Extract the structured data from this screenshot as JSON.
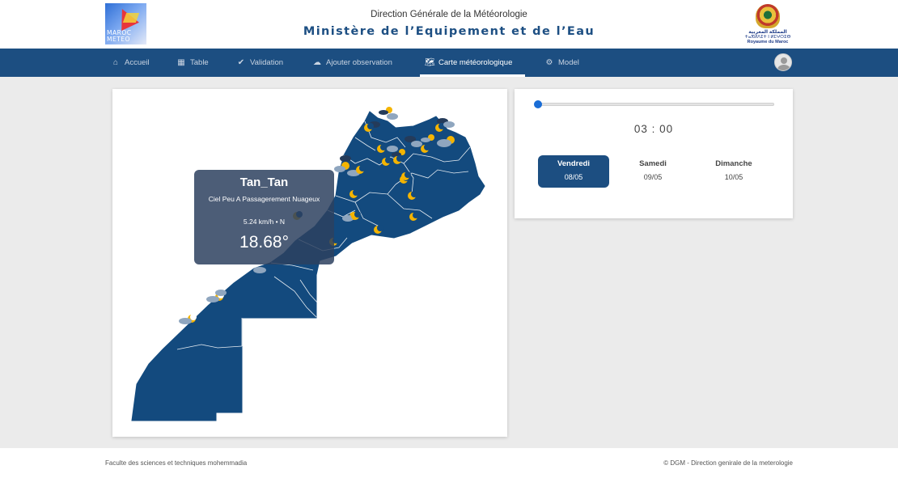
{
  "header": {
    "left_logo": {
      "icon": "meteo-maroc-logo",
      "lines": [
        "MAROC",
        "METEO"
      ]
    },
    "title_line1": "Direction Générale de la Météorologie",
    "title_line2": "Ministère de l’Equipement et de l’Eau",
    "right_logo": {
      "icon": "kingdom-crest-logo",
      "line1": "المملكة المغربية",
      "line2": "ⵜⴰⴳⵍⴷⵉⵜ ⵏ ⵍⵎⵖⵔⵉⴱ",
      "line3": "Royaume du Maroc"
    }
  },
  "nav": {
    "items": [
      {
        "label": "Accueil",
        "icon": "home-icon"
      },
      {
        "label": "Table",
        "icon": "table-icon"
      },
      {
        "label": "Validation",
        "icon": "check-icon"
      },
      {
        "label": "Ajouter observation",
        "icon": "cloud-upload-icon"
      },
      {
        "label": "Carte météorologique",
        "icon": "map-icon",
        "active": true
      },
      {
        "label": "Model",
        "icon": "cogs-icon"
      }
    ],
    "user_icon": "user-avatar-icon"
  },
  "map": {
    "tooltip": {
      "city": "Tan_Tan",
      "description": "Ciel Peu A Passagerement Nuageux",
      "wind": "5.24 km/h • N",
      "temperature": "18.68°"
    },
    "weather_icons": [
      "moon-icon",
      "cloud-icon",
      "rain-cloud-icon",
      "partly-cloudy-night-icon"
    ],
    "colors": {
      "land": "#134a7e",
      "border": "#ffffff",
      "moon": "#f4b400",
      "cloud": "#8fa6bf"
    }
  },
  "forecast": {
    "slider_value": 0,
    "time": "03 : 00",
    "days": [
      {
        "name": "Vendredi",
        "date": "08/05",
        "active": true
      },
      {
        "name": "Samedi",
        "date": "09/05",
        "active": false
      },
      {
        "name": "Dimanche",
        "date": "10/05",
        "active": false
      }
    ]
  },
  "footer": {
    "left": "Faculte des sciences et techniques mohemmadia",
    "right": "© DGM - Direction genirale de la meterologie"
  }
}
